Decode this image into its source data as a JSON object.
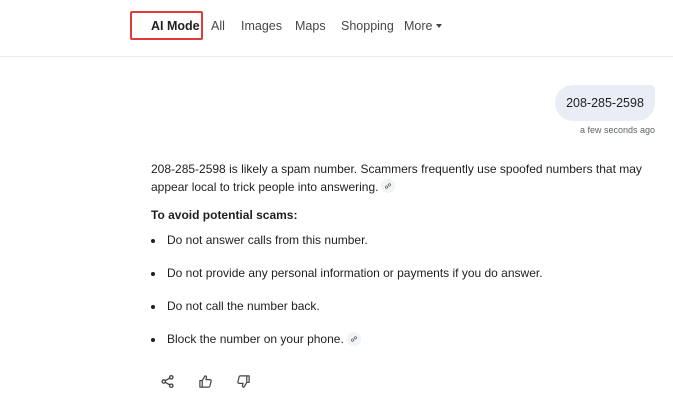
{
  "nav": {
    "tabs": [
      {
        "label": "AI Mode",
        "active": true
      },
      {
        "label": "All"
      },
      {
        "label": "Images"
      },
      {
        "label": "Maps"
      },
      {
        "label": "Shopping"
      },
      {
        "label": "More"
      }
    ],
    "highlight_color": "#e03a3a"
  },
  "query": {
    "text": "208-285-2598",
    "timestamp": "a few seconds ago"
  },
  "answer": {
    "intro": "208-285-2598 is likely a spam number. Scammers frequently use spoofed numbers that may appear local to trick people into answering.",
    "heading": "To avoid potential scams:",
    "bullets": [
      "Do not answer calls from this number.",
      "Do not provide any personal information or payments if you do answer.",
      "Do not call the number back.",
      "Block the number on your phone."
    ]
  },
  "actions": {
    "icons": [
      "share-icon",
      "thumbs-up-icon",
      "thumbs-down-icon"
    ]
  }
}
